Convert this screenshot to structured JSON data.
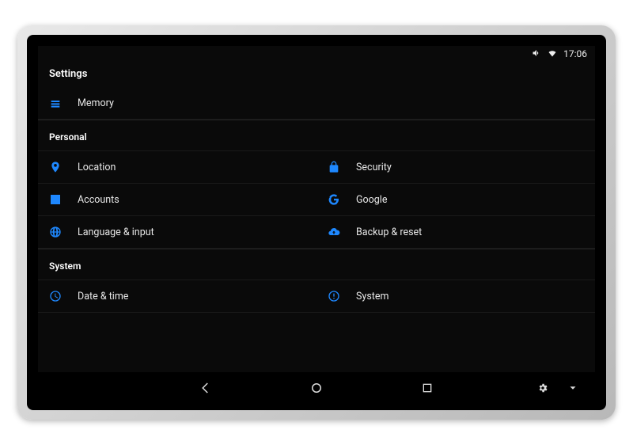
{
  "statusbar": {
    "time": "17:06"
  },
  "app_title": "Settings",
  "top_item": {
    "label": "Memory"
  },
  "sections": {
    "personal": {
      "header": "Personal",
      "items": [
        {
          "label": "Location"
        },
        {
          "label": "Security"
        },
        {
          "label": "Accounts"
        },
        {
          "label": "Google"
        },
        {
          "label": "Language & input"
        },
        {
          "label": "Backup & reset"
        }
      ]
    },
    "system": {
      "header": "System",
      "items": [
        {
          "label": "Date & time"
        },
        {
          "label": "System"
        }
      ]
    }
  }
}
